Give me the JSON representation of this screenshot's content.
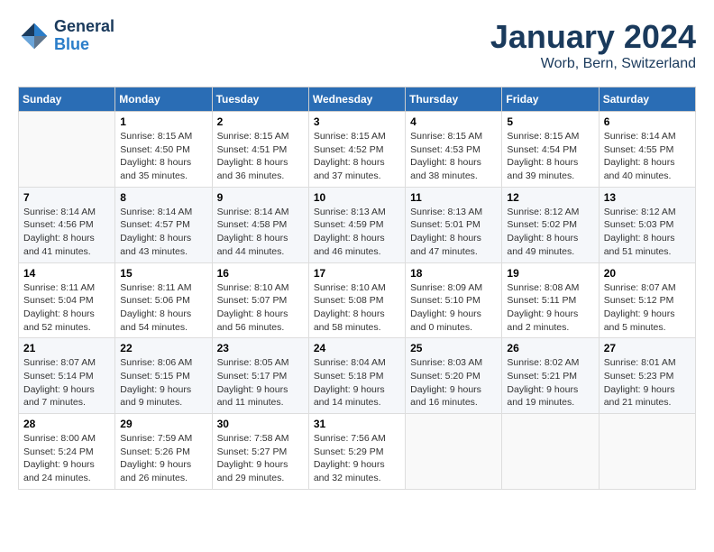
{
  "header": {
    "logo_line1": "General",
    "logo_line2": "Blue",
    "month": "January 2024",
    "location": "Worb, Bern, Switzerland"
  },
  "weekdays": [
    "Sunday",
    "Monday",
    "Tuesday",
    "Wednesday",
    "Thursday",
    "Friday",
    "Saturday"
  ],
  "weeks": [
    [
      {
        "day": "",
        "info": ""
      },
      {
        "day": "1",
        "info": "Sunrise: 8:15 AM\nSunset: 4:50 PM\nDaylight: 8 hours\nand 35 minutes."
      },
      {
        "day": "2",
        "info": "Sunrise: 8:15 AM\nSunset: 4:51 PM\nDaylight: 8 hours\nand 36 minutes."
      },
      {
        "day": "3",
        "info": "Sunrise: 8:15 AM\nSunset: 4:52 PM\nDaylight: 8 hours\nand 37 minutes."
      },
      {
        "day": "4",
        "info": "Sunrise: 8:15 AM\nSunset: 4:53 PM\nDaylight: 8 hours\nand 38 minutes."
      },
      {
        "day": "5",
        "info": "Sunrise: 8:15 AM\nSunset: 4:54 PM\nDaylight: 8 hours\nand 39 minutes."
      },
      {
        "day": "6",
        "info": "Sunrise: 8:14 AM\nSunset: 4:55 PM\nDaylight: 8 hours\nand 40 minutes."
      }
    ],
    [
      {
        "day": "7",
        "info": "Sunrise: 8:14 AM\nSunset: 4:56 PM\nDaylight: 8 hours\nand 41 minutes."
      },
      {
        "day": "8",
        "info": "Sunrise: 8:14 AM\nSunset: 4:57 PM\nDaylight: 8 hours\nand 43 minutes."
      },
      {
        "day": "9",
        "info": "Sunrise: 8:14 AM\nSunset: 4:58 PM\nDaylight: 8 hours\nand 44 minutes."
      },
      {
        "day": "10",
        "info": "Sunrise: 8:13 AM\nSunset: 4:59 PM\nDaylight: 8 hours\nand 46 minutes."
      },
      {
        "day": "11",
        "info": "Sunrise: 8:13 AM\nSunset: 5:01 PM\nDaylight: 8 hours\nand 47 minutes."
      },
      {
        "day": "12",
        "info": "Sunrise: 8:12 AM\nSunset: 5:02 PM\nDaylight: 8 hours\nand 49 minutes."
      },
      {
        "day": "13",
        "info": "Sunrise: 8:12 AM\nSunset: 5:03 PM\nDaylight: 8 hours\nand 51 minutes."
      }
    ],
    [
      {
        "day": "14",
        "info": "Sunrise: 8:11 AM\nSunset: 5:04 PM\nDaylight: 8 hours\nand 52 minutes."
      },
      {
        "day": "15",
        "info": "Sunrise: 8:11 AM\nSunset: 5:06 PM\nDaylight: 8 hours\nand 54 minutes."
      },
      {
        "day": "16",
        "info": "Sunrise: 8:10 AM\nSunset: 5:07 PM\nDaylight: 8 hours\nand 56 minutes."
      },
      {
        "day": "17",
        "info": "Sunrise: 8:10 AM\nSunset: 5:08 PM\nDaylight: 8 hours\nand 58 minutes."
      },
      {
        "day": "18",
        "info": "Sunrise: 8:09 AM\nSunset: 5:10 PM\nDaylight: 9 hours\nand 0 minutes."
      },
      {
        "day": "19",
        "info": "Sunrise: 8:08 AM\nSunset: 5:11 PM\nDaylight: 9 hours\nand 2 minutes."
      },
      {
        "day": "20",
        "info": "Sunrise: 8:07 AM\nSunset: 5:12 PM\nDaylight: 9 hours\nand 5 minutes."
      }
    ],
    [
      {
        "day": "21",
        "info": "Sunrise: 8:07 AM\nSunset: 5:14 PM\nDaylight: 9 hours\nand 7 minutes."
      },
      {
        "day": "22",
        "info": "Sunrise: 8:06 AM\nSunset: 5:15 PM\nDaylight: 9 hours\nand 9 minutes."
      },
      {
        "day": "23",
        "info": "Sunrise: 8:05 AM\nSunset: 5:17 PM\nDaylight: 9 hours\nand 11 minutes."
      },
      {
        "day": "24",
        "info": "Sunrise: 8:04 AM\nSunset: 5:18 PM\nDaylight: 9 hours\nand 14 minutes."
      },
      {
        "day": "25",
        "info": "Sunrise: 8:03 AM\nSunset: 5:20 PM\nDaylight: 9 hours\nand 16 minutes."
      },
      {
        "day": "26",
        "info": "Sunrise: 8:02 AM\nSunset: 5:21 PM\nDaylight: 9 hours\nand 19 minutes."
      },
      {
        "day": "27",
        "info": "Sunrise: 8:01 AM\nSunset: 5:23 PM\nDaylight: 9 hours\nand 21 minutes."
      }
    ],
    [
      {
        "day": "28",
        "info": "Sunrise: 8:00 AM\nSunset: 5:24 PM\nDaylight: 9 hours\nand 24 minutes."
      },
      {
        "day": "29",
        "info": "Sunrise: 7:59 AM\nSunset: 5:26 PM\nDaylight: 9 hours\nand 26 minutes."
      },
      {
        "day": "30",
        "info": "Sunrise: 7:58 AM\nSunset: 5:27 PM\nDaylight: 9 hours\nand 29 minutes."
      },
      {
        "day": "31",
        "info": "Sunrise: 7:56 AM\nSunset: 5:29 PM\nDaylight: 9 hours\nand 32 minutes."
      },
      {
        "day": "",
        "info": ""
      },
      {
        "day": "",
        "info": ""
      },
      {
        "day": "",
        "info": ""
      }
    ]
  ]
}
